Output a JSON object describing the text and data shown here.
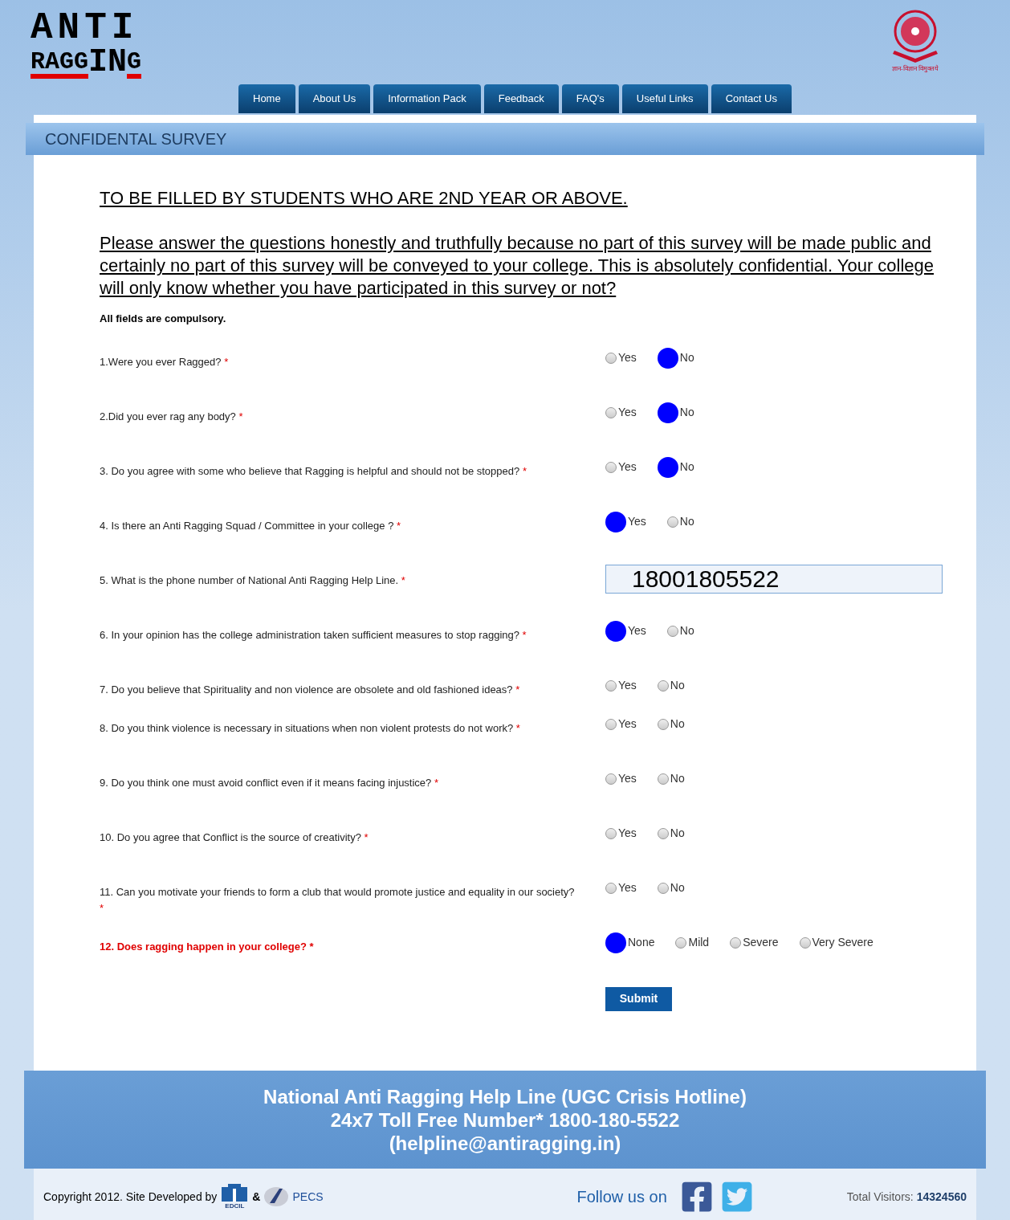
{
  "logo": {
    "line_1": "ANTI",
    "line_2": "RAGG",
    "line_3": "IN",
    "line_4": "G"
  },
  "emblem": {
    "motto": "ज्ञान-विज्ञान विमुक्तये"
  },
  "nav": [
    {
      "label": "Home"
    },
    {
      "label": "About Us"
    },
    {
      "label": "Information Pack"
    },
    {
      "label": "Feedback"
    },
    {
      "label": "FAQ's"
    },
    {
      "label": "Useful Links"
    },
    {
      "label": "Contact Us"
    }
  ],
  "panel_title": "CONFIDENTAL SURVEY",
  "heading": "TO BE FILLED BY STUDENTS WHO ARE 2ND YEAR OR ABOVE.",
  "intro": "Please answer the questions honestly and truthfully because no part of this survey will be made public and certainly no part of this survey will be conveyed to your college. This is absolutely confidential. Your college will only know whether you have participated in this survey or not?",
  "note": "All fields are compulsory.",
  "questions": [
    {
      "kind": "radio",
      "text": "1.Were you ever Ragged?",
      "required": "*",
      "highlight": false,
      "options": [
        {
          "label": "Yes",
          "selected": false
        },
        {
          "label": "No",
          "selected": true
        }
      ]
    },
    {
      "kind": "radio",
      "text": "2.Did you ever rag any body?",
      "required": "*",
      "highlight": false,
      "options": [
        {
          "label": "Yes",
          "selected": false
        },
        {
          "label": "No",
          "selected": true
        }
      ]
    },
    {
      "kind": "radio",
      "text": "3. Do you agree with some who believe that Ragging is helpful and should not be stopped?",
      "required": "*",
      "highlight": false,
      "options": [
        {
          "label": "Yes",
          "selected": false
        },
        {
          "label": "No",
          "selected": true
        }
      ]
    },
    {
      "kind": "radio",
      "text": "4. Is there an Anti Ragging Squad / Committee in your college ?",
      "required": "*",
      "highlight": false,
      "options": [
        {
          "label": "Yes",
          "selected": true
        },
        {
          "label": "No",
          "selected": false
        }
      ]
    },
    {
      "kind": "text",
      "text": "5. What is the phone number of National Anti Ragging Help Line.",
      "required": "*",
      "highlight": false,
      "value": "18001805522"
    },
    {
      "kind": "radio",
      "text": "6. In your opinion has the college administration taken sufficient measures to stop ragging?",
      "required": "*",
      "highlight": false,
      "options": [
        {
          "label": "Yes",
          "selected": true
        },
        {
          "label": "No",
          "selected": false
        }
      ]
    },
    {
      "kind": "radio",
      "text": "7. Do you believe that Spirituality and non violence are obsolete and old fashioned ideas?",
      "required": "*",
      "highlight": false,
      "options": [
        {
          "label": "Yes",
          "selected": false
        },
        {
          "label": "No",
          "selected": false
        }
      ]
    },
    {
      "kind": "radio",
      "text": "8. Do you think violence is necessary in situations when non violent protests do not work?",
      "required": "*",
      "highlight": false,
      "options": [
        {
          "label": "Yes",
          "selected": false
        },
        {
          "label": "No",
          "selected": false
        }
      ]
    },
    {
      "kind": "radio",
      "text": "9. Do you think one must avoid conflict even if it means facing injustice?",
      "required": "*",
      "highlight": false,
      "options": [
        {
          "label": "Yes",
          "selected": false
        },
        {
          "label": "No",
          "selected": false
        }
      ]
    },
    {
      "kind": "radio",
      "text": "10. Do you agree that Conflict is the source of creativity?",
      "required": "*",
      "highlight": false,
      "options": [
        {
          "label": "Yes",
          "selected": false
        },
        {
          "label": "No",
          "selected": false
        }
      ]
    },
    {
      "kind": "radio",
      "text": "11. Can you motivate your friends to form a club that would promote justice and equality in our society?",
      "required": "*",
      "highlight": false,
      "options": [
        {
          "label": "Yes",
          "selected": false
        },
        {
          "label": "No",
          "selected": false
        }
      ]
    },
    {
      "kind": "radio",
      "text": "12. Does ragging happen in your college?",
      "required": "*",
      "highlight": true,
      "options": [
        {
          "label": "None",
          "selected": true
        },
        {
          "label": "Mild",
          "selected": false
        },
        {
          "label": "Severe",
          "selected": false
        },
        {
          "label": "Very Severe",
          "selected": false
        }
      ]
    }
  ],
  "submit": "Submit",
  "helpline": {
    "line_1": "National Anti Ragging Help Line (UGC Crisis Hotline)",
    "line_2": "24x7 Toll Free Number* 1800-180-5522",
    "line_3": "(helpline@antiragging.in)"
  },
  "footer": {
    "copyright": "Copyright 2012. Site Developed by",
    "edcil": "EDCIL",
    "amp": "&",
    "pecs": "PECS",
    "follow": "Follow us on",
    "visitors_label": "Total Visitors:",
    "visitors": "14324560"
  }
}
